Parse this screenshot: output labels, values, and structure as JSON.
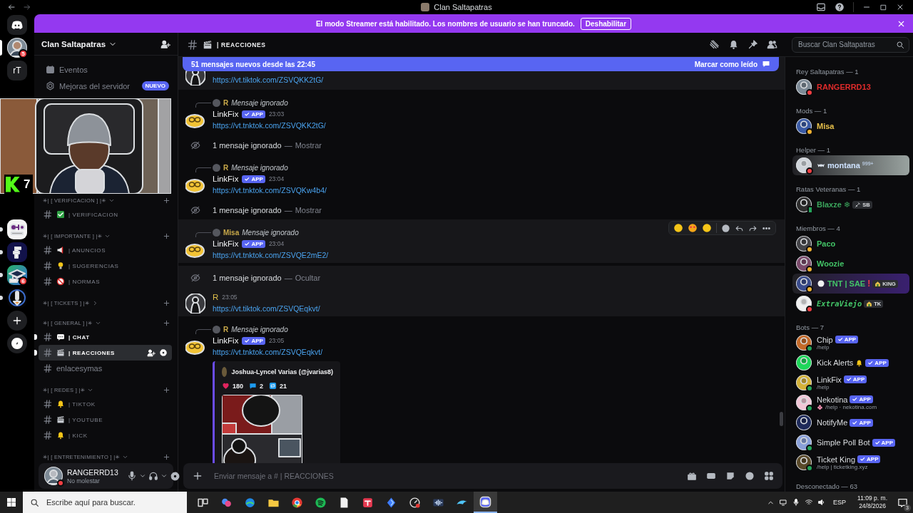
{
  "titlebar": {
    "title": "Clan Saltapatras"
  },
  "banner": {
    "text": "El modo Streamer está habilitado. Los nombres de usuario se han truncado.",
    "button": "Deshabilitar"
  },
  "servers": [
    {
      "kind": "discord",
      "selected": false,
      "unread": false
    },
    {
      "kind": "avatar",
      "badge": "5",
      "selected": true,
      "unread": false
    },
    {
      "kind": "initials",
      "label": "rT",
      "selected": false,
      "unread": false
    },
    {
      "kind": "dm",
      "selected": false,
      "unread": true
    },
    {
      "kind": "f",
      "selected": false,
      "unread": true
    },
    {
      "kind": "cap",
      "badge": "6",
      "selected": false,
      "unread": true
    },
    {
      "kind": "rocket",
      "selected": false,
      "unread": true
    },
    {
      "kind": "add",
      "selected": false,
      "unread": false
    },
    {
      "kind": "discover",
      "selected": false,
      "unread": false
    }
  ],
  "webcam": {
    "kind": "picture",
    "overlay_count": "7"
  },
  "server": {
    "name": "Clan Saltapatras",
    "shortcuts": [
      {
        "kind": "events",
        "label": "Eventos"
      },
      {
        "kind": "boost",
        "label": "Mejoras del servidor",
        "badge": "NUEVO"
      }
    ]
  },
  "categories": [
    {
      "label": "✳| [ VERIFICACION ] |✳",
      "expanded": true,
      "channels": [
        {
          "kind": "check",
          "label": "| VERIFICACION",
          "selected": false,
          "unread": false
        }
      ]
    },
    {
      "label": "✳| [ IMPORTANTE ] |✳",
      "expanded": true,
      "channels": [
        {
          "kind": "megaphone",
          "label": "| ANUNCIOS",
          "selected": false,
          "unread": false
        },
        {
          "kind": "bulb",
          "label": "| SUGERENCIAS",
          "selected": false,
          "unread": false
        },
        {
          "kind": "nosign",
          "label": "| NORMAS",
          "selected": false,
          "unread": false
        }
      ]
    },
    {
      "label": "✳| [ TICKETS ] |✳",
      "expanded": false
    },
    {
      "label": "✳| [ GENERAL ] |✳",
      "expanded": true,
      "channels": [
        {
          "kind": "speech",
          "label": "| CHAT",
          "selected": false,
          "unread": true
        },
        {
          "kind": "clapper",
          "label": "| REACCIONES",
          "selected": true,
          "unread": true
        },
        {
          "kind": "plain",
          "label": "enlacesymas",
          "selected": false,
          "unread": false
        }
      ]
    },
    {
      "label": "✳| [ REDES ] |✳",
      "expanded": true,
      "channels": [
        {
          "kind": "bell",
          "label": "| TIKTOK",
          "selected": false,
          "unread": false
        },
        {
          "kind": "clapper",
          "label": "| YOUTUBE",
          "selected": false,
          "unread": false
        },
        {
          "kind": "bell",
          "label": "| KICK",
          "selected": false,
          "unread": false
        }
      ]
    },
    {
      "label": "✳| [ ENTRETENIMIENTO ] |✳",
      "expanded": true
    }
  ],
  "user": {
    "name": "RANGERRD13",
    "status": "No molestar"
  },
  "channel_header": {
    "kind": "clapper",
    "name": "| REACCIONES",
    "search_placeholder": "Buscar Clan Saltapatras"
  },
  "new_messages_bar": {
    "text": "51 mensajes nuevos desde las 22:45",
    "action": "Marcar como leído"
  },
  "messages": [
    {
      "kind": "clipped",
      "link": "https://vt.tiktok.com/ZSVQKK2tG/",
      "highlighted": true,
      "hovered": false
    },
    {
      "kind": "message",
      "reply": {
        "author": "R",
        "color": "#c9a94a",
        "text": "Mensaje ignorado"
      },
      "author": "LinkFix",
      "badge": "APP",
      "time": "23:03",
      "link": "https://vt.tnktok.com/ZSVQKK2tG/",
      "highlighted": false,
      "hovered": false
    },
    {
      "kind": "ignored",
      "text": "1 mensaje ignorado",
      "dash": "—",
      "action": "Mostrar",
      "highlighted": false,
      "hovered": false
    },
    {
      "kind": "message",
      "reply": {
        "author": "R",
        "color": "#c9a94a",
        "text": "Mensaje ignorado"
      },
      "author": "LinkFix",
      "badge": "APP",
      "time": "23:04",
      "link": "https://vt.tnktok.com/ZSVQKw4b4/",
      "highlighted": false,
      "hovered": false
    },
    {
      "kind": "ignored",
      "text": "1 mensaje ignorado",
      "dash": "—",
      "action": "Mostrar",
      "highlighted": false,
      "hovered": false
    },
    {
      "kind": "message",
      "reply": {
        "author": "Misa",
        "color": "#c9a94a",
        "text": "Mensaje ignorado"
      },
      "author": "LinkFix",
      "badge": "APP",
      "time": "23:04",
      "link": "https://vt.tnktok.com/ZSVQE2mE2/",
      "highlighted": true,
      "hovered": true
    },
    {
      "kind": "ignored",
      "text": "1 mensaje ignorado",
      "dash": "—",
      "action": "Ocultar",
      "highlighted": true,
      "hovered": false
    },
    {
      "kind": "message",
      "author": "R",
      "color": "#e0c04c",
      "time": "23:05",
      "link": "https://vt.tiktok.com/ZSVQEqkvt/",
      "highlighted": true,
      "hovered": false
    },
    {
      "kind": "message",
      "reply": {
        "author": "R",
        "color": "#c9a94a",
        "text": "Mensaje ignorado"
      },
      "author": "LinkFix",
      "badge": "APP",
      "time": "23:05",
      "link": "https://vt.tnktok.com/ZSVQEqkvt/",
      "highlighted": false,
      "hovered": false,
      "embed": {
        "author": "Joshua-Lyncel Varias (@jvarias8)",
        "stats": [
          {
            "kind": "heart",
            "count": "180"
          },
          {
            "kind": "comment",
            "count": "2"
          },
          {
            "kind": "repost",
            "count": "21"
          }
        ]
      }
    }
  ],
  "composer": {
    "placeholder": "Enviar mensaje a # | REACCIONES"
  },
  "member_groups": [
    {
      "title": "Rey Saltapatras — 1",
      "members": [
        {
          "name": "RANGERRD13",
          "color": "#e02b2b",
          "status": {
            "kind": "minus",
            "color": "#f23f43"
          }
        }
      ]
    },
    {
      "title": "Mods — 1",
      "members": [
        {
          "name": "Misa",
          "color": "#e8c14b",
          "status": {
            "kind": "moon",
            "color": "#f0b232"
          }
        }
      ]
    },
    {
      "title": "Helper — 1",
      "members": [
        {
          "name": "montana",
          "color": "#cfe3ff",
          "status": {
            "kind": "minus",
            "color": "#f23f43"
          },
          "card": {
            "color": "#9aa3a0"
          },
          "prefix": {
            "kind": "bat"
          },
          "sup": "999+"
        }
      ]
    },
    {
      "title": "Ratas Veteranas — 1",
      "members": [
        {
          "name": "Blaxze ❄",
          "color": "#3ba55c",
          "status": {
            "kind": "phone",
            "color": "#23a55a"
          },
          "tag": {
            "kind": "sword",
            "text": "SB"
          }
        }
      ]
    },
    {
      "title": "Miembros — 4",
      "members": [
        {
          "name": "Paco",
          "color": "#43c467",
          "status": {
            "kind": "moon",
            "color": "#f0b232"
          }
        },
        {
          "name": "Woozie",
          "color": "#43c467",
          "status": {
            "kind": "moon",
            "color": "#f0b232"
          }
        },
        {
          "name": "TNT | SAE",
          "color": "#43c467",
          "status": {
            "kind": "moon",
            "color": "#f0b232"
          },
          "card": {
            "color": "#3a2070"
          },
          "prefix": {
            "kind": "circle"
          },
          "suffix": "!",
          "tag": {
            "kind": "house",
            "text": "KING"
          }
        },
        {
          "name": "ExtraViejo",
          "color": "#43c467",
          "italic": true,
          "status": {
            "kind": "minus",
            "color": "#f23f43"
          },
          "tag": {
            "kind": "house",
            "text": "TK"
          }
        }
      ]
    },
    {
      "title": "Bots — 7",
      "members": [
        {
          "name": "Chip",
          "badge": "APP",
          "subtitle": "/help",
          "status": {
            "kind": "dot",
            "color": "#23a55a"
          }
        },
        {
          "name": "Kick Alerts",
          "name_icon": {
            "kind": "bell"
          },
          "badge": "APP"
        },
        {
          "name": "LinkFix",
          "badge": "APP",
          "subtitle": "/help",
          "status": {
            "kind": "dot",
            "color": "#23a55a"
          }
        },
        {
          "name": "Nekotina",
          "badge": "APP",
          "subtitle": "/help · nekotina.com",
          "subtitle_icon": {
            "kind": "flower"
          },
          "status": {
            "kind": "dot",
            "color": "#23a55a"
          }
        },
        {
          "name": "NotifyMe",
          "badge": "APP"
        },
        {
          "name": "Simple Poll Bot",
          "badge": "APP",
          "status": {
            "kind": "dot",
            "color": "#23a55a"
          }
        },
        {
          "name": "Ticket King",
          "badge": "APP",
          "subtitle": "/help | ticketking.xyz",
          "status": {
            "kind": "dot",
            "color": "#23a55a"
          }
        }
      ]
    },
    {
      "title": "Desconectado — 63"
    }
  ],
  "taskbar": {
    "search_placeholder": "Escribe aquí para buscar.",
    "apps": [
      {
        "kind": "taskview",
        "selected": false
      },
      {
        "kind": "swirl",
        "selected": false
      },
      {
        "kind": "globe",
        "selected": false
      },
      {
        "kind": "folder",
        "selected": false
      },
      {
        "kind": "chrome",
        "selected": false
      },
      {
        "kind": "spotify",
        "selected": false
      },
      {
        "kind": "file",
        "selected": false
      },
      {
        "kind": "redsquare",
        "selected": false
      },
      {
        "kind": "diamond",
        "selected": false
      },
      {
        "kind": "gauge",
        "selected": false
      },
      {
        "kind": "audio",
        "selected": false
      },
      {
        "kind": "dolphin",
        "selected": false
      },
      {
        "kind": "discord",
        "selected": true
      }
    ],
    "language": "ESP",
    "time": "11:09 p. m.",
    "date": "24/8/2026",
    "notifications": "3"
  }
}
